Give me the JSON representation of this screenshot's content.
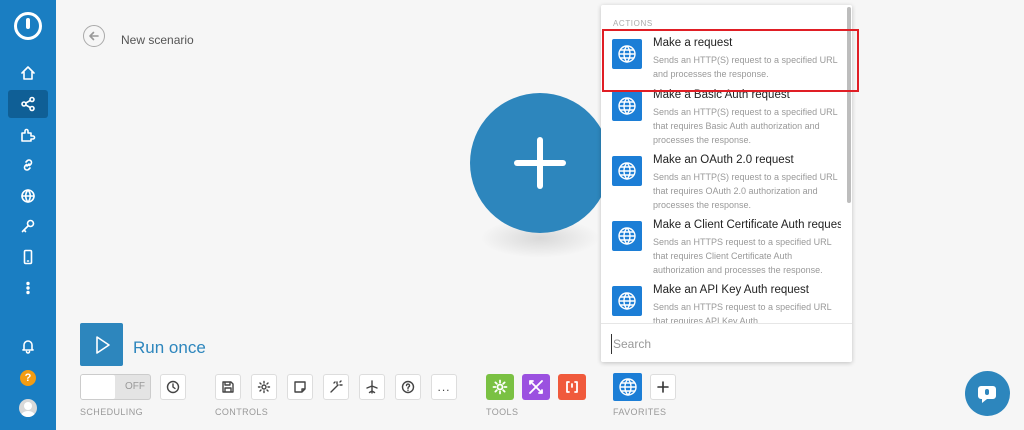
{
  "header": {
    "scenario_title": "New scenario"
  },
  "run": {
    "label": "Run once"
  },
  "scheduling": {
    "toggle_label": "OFF",
    "section_label": "SCHEDULING"
  },
  "controls": {
    "section_label": "CONTROLS",
    "more_label": "..."
  },
  "tools": {
    "section_label": "TOOLS",
    "colors": [
      "#7ac143",
      "#9b51e0",
      "#f05a3c"
    ]
  },
  "favorites": {
    "section_label": "FAVORITES"
  },
  "sidebar": {
    "icons": [
      "home-icon",
      "share-icon",
      "puzzle-icon",
      "link-icon",
      "globe-icon",
      "key-icon",
      "mobile-icon",
      "more-vertical-icon"
    ],
    "help_label": "?"
  },
  "popup": {
    "section": "ACTIONS",
    "items": [
      {
        "title": "Make a request",
        "desc": "Sends an HTTP(S) request to a specified URL and processes the response."
      },
      {
        "title": "Make a Basic Auth request",
        "desc": "Sends an HTTP(S) request to a specified URL that requires Basic Auth authorization and processes the response."
      },
      {
        "title": "Make an OAuth 2.0 request",
        "desc": "Sends an HTTP(S) request to a specified URL that requires OAuth 2.0 authorization and processes the response."
      },
      {
        "title": "Make a Client Certificate Auth request",
        "desc": "Sends an HTTPS request to a specified URL that requires Client Certificate Auth authorization and processes the response."
      },
      {
        "title": "Make an API Key Auth request",
        "desc": "Sends an HTTPS request to a specified URL that requires API Key Auth"
      }
    ],
    "search_placeholder": "Search"
  },
  "colors": {
    "sidebar": "#1a7ec2",
    "accent": "#2d86bd",
    "module": "#1c7ed6",
    "highlight": "#e01e25"
  }
}
